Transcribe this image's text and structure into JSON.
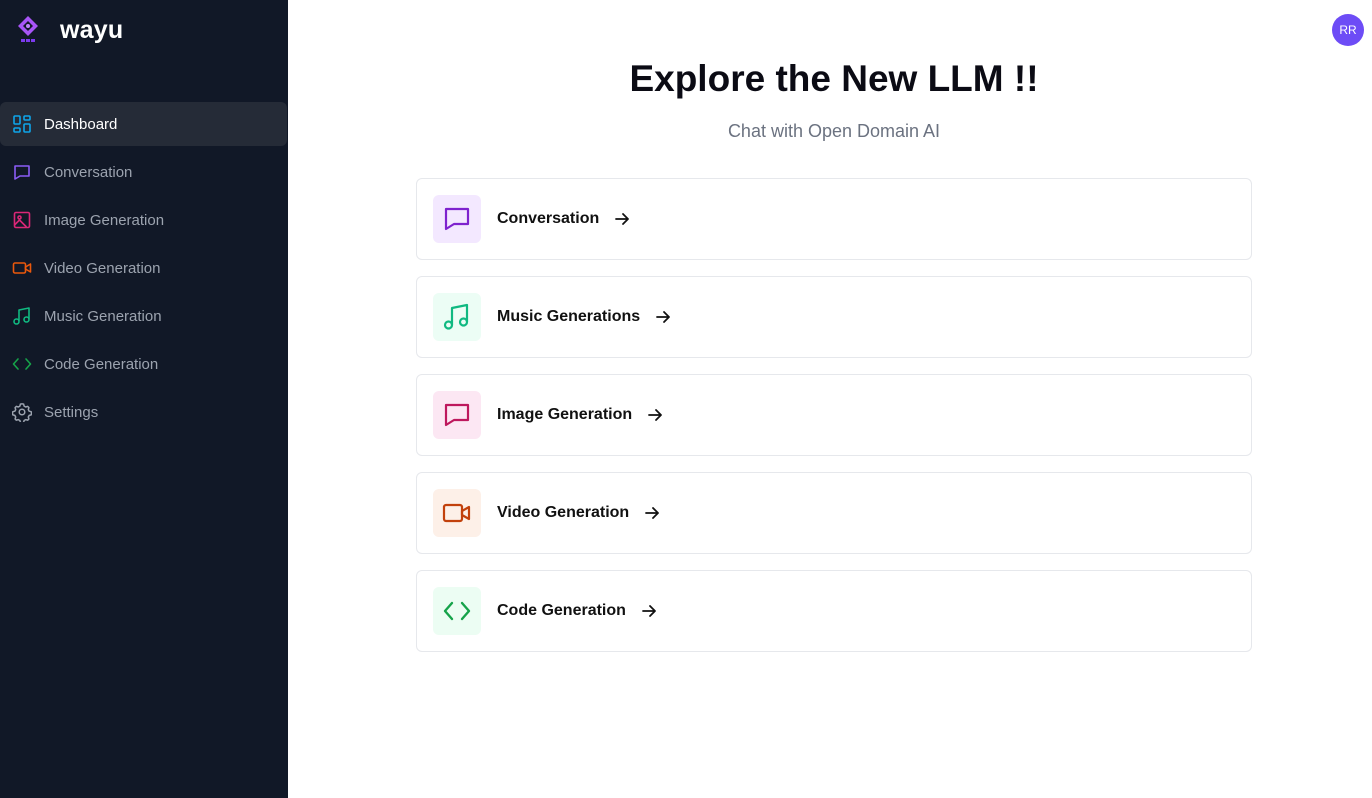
{
  "brand": {
    "name": "wayu"
  },
  "sidebar": {
    "items": [
      {
        "label": "Dashboard",
        "icon": "dashboard-icon",
        "color": "#0ea5e9",
        "active": true
      },
      {
        "label": "Conversation",
        "icon": "chat-icon",
        "color": "#8b5cf6"
      },
      {
        "label": "Image Generation",
        "icon": "image-icon",
        "color": "#db2777"
      },
      {
        "label": "Video Generation",
        "icon": "video-icon",
        "color": "#ea580c"
      },
      {
        "label": "Music Generation",
        "icon": "music-icon",
        "color": "#10b981"
      },
      {
        "label": "Code Generation",
        "icon": "code-icon",
        "color": "#16a34a"
      },
      {
        "label": "Settings",
        "icon": "gear-icon",
        "color": "#9ca3af"
      }
    ]
  },
  "header": {
    "avatar_initials": "RR"
  },
  "main": {
    "title": "Explore the New LLM !!",
    "subtitle": "Chat with Open Domain AI",
    "cards": [
      {
        "label": "Conversation",
        "icon": "chat-icon",
        "color": "#7e22ce",
        "bg": "#f3e8ff"
      },
      {
        "label": "Music Generations",
        "icon": "music-icon",
        "color": "#10b981",
        "bg": "#ecfdf5"
      },
      {
        "label": "Image Generation",
        "icon": "chat-icon",
        "color": "#be185d",
        "bg": "#fce7f3"
      },
      {
        "label": "Video Generation",
        "icon": "video-icon",
        "color": "#c2410c",
        "bg": "#fdf0e8"
      },
      {
        "label": "Code Generation",
        "icon": "code-icon",
        "color": "#16a34a",
        "bg": "#ecfdf3"
      }
    ]
  }
}
